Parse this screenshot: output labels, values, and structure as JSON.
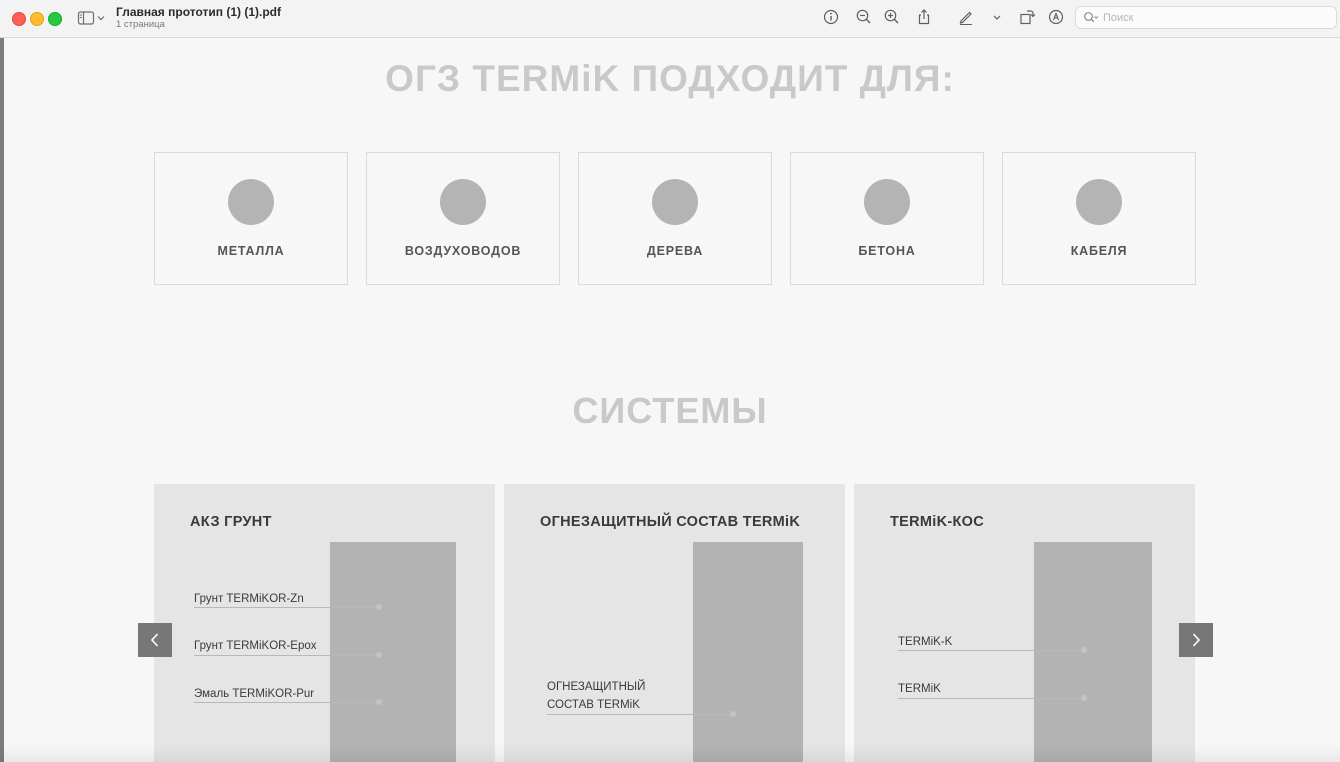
{
  "window": {
    "title": "Главная прототип (1) (1).pdf",
    "subtitle": "1 страница"
  },
  "toolbar": {
    "icons": [
      "sidebar-icon",
      "chevron-down-icon",
      "info-icon",
      "zoom-out-icon",
      "zoom-in-icon",
      "share-icon",
      "markup-pen-icon",
      "chevron-down-icon",
      "rotate-icon",
      "annotate-icon"
    ],
    "search": {
      "placeholder": "Поиск"
    }
  },
  "applications": {
    "heading": "ОГЗ TERMiK ПОДХОДИТ ДЛЯ:",
    "items": [
      {
        "label": "МЕТАЛЛА"
      },
      {
        "label": "ВОЗДУХОВОДОВ"
      },
      {
        "label": "ДЕРЕВА"
      },
      {
        "label": "БЕТОНА"
      },
      {
        "label": "КАБЕЛЯ"
      }
    ]
  },
  "systems": {
    "heading": "СИСТЕМЫ",
    "cards": [
      {
        "title": "АКЗ ГРУНТ",
        "callouts": [
          "Грунт TERMiKOR-Zn",
          "Грунт TERMiKOR-Epox",
          "Эмаль TERMiKOR-Pur"
        ]
      },
      {
        "title": "ОГНЕЗАЩИТНЫЙ СОСТАВ TERMiK",
        "callouts": [
          "ОГНЕЗАЩИТНЫЙ",
          "СОСТАВ TERMiK"
        ]
      },
      {
        "title": "TERMiK-КОС",
        "callouts": [
          "TERMiK-K",
          "TERMiK"
        ]
      }
    ]
  },
  "colors": {
    "heading": "#c9c9c9",
    "card_bg": "#e5e5e5",
    "placeholder": "#b3b3b3",
    "arrow_bg": "#777777"
  }
}
